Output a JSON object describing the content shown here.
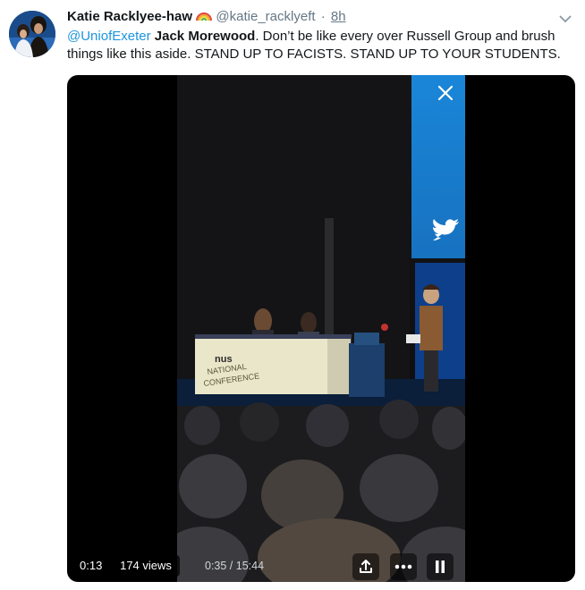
{
  "tweet": {
    "display_name": "Katie Racklyee-haw",
    "name_emoji": "rainbow-emoji",
    "handle": "@katie_racklyeft",
    "separator": "·",
    "time": "8h",
    "mention": "@UniofExeter",
    "bold_name": "Jack Morewood",
    "body_line1": ". Don’t be like every over Russell Group and brush",
    "body_line2": "things like this aside. STAND UP TO FACISTS. STAND UP TO YOUR STUDENTS."
  },
  "video": {
    "elapsed": "0:13",
    "views": "174 views",
    "duration": "0:35 / 15:44",
    "banner_logo": "nus",
    "banner_line1": "NATIONAL",
    "banner_line2": "CONFERENCE",
    "icons": [
      "close-icon",
      "share-icon",
      "more-icon",
      "pause-icon",
      "twitter-bird-icon"
    ]
  },
  "colors": {
    "link": "#1b95e0",
    "text": "#14171a",
    "muted": "#657786",
    "stage_blue": "#1e88d6"
  }
}
